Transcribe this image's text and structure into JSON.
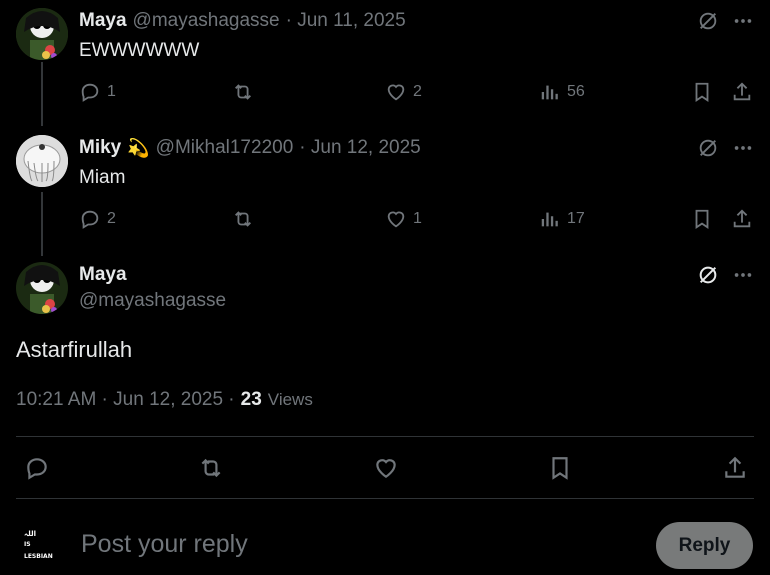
{
  "tweets": [
    {
      "name": "Maya",
      "handle": "@mayashagasse",
      "date": "· Jun 11, 2025",
      "text": "EWWWWWW",
      "replies": "1",
      "likes": "2",
      "views": "56"
    },
    {
      "name": "Miky",
      "emoji": "💫",
      "handle": "@Mikhal172200",
      "date": "· Jun 12, 2025",
      "text": "Miam",
      "replies": "2",
      "likes": "1",
      "views": "17"
    }
  ],
  "main": {
    "name": "Maya",
    "handle": "@mayashagasse",
    "text": "Astarfirullah",
    "timestamp": "10:21 AM · Jun 12, 2025 ·",
    "views_count": "23",
    "views_label": "Views"
  },
  "composer": {
    "avatar_text": "LESBIAN",
    "placeholder": "Post your reply",
    "reply_label": "Reply"
  }
}
